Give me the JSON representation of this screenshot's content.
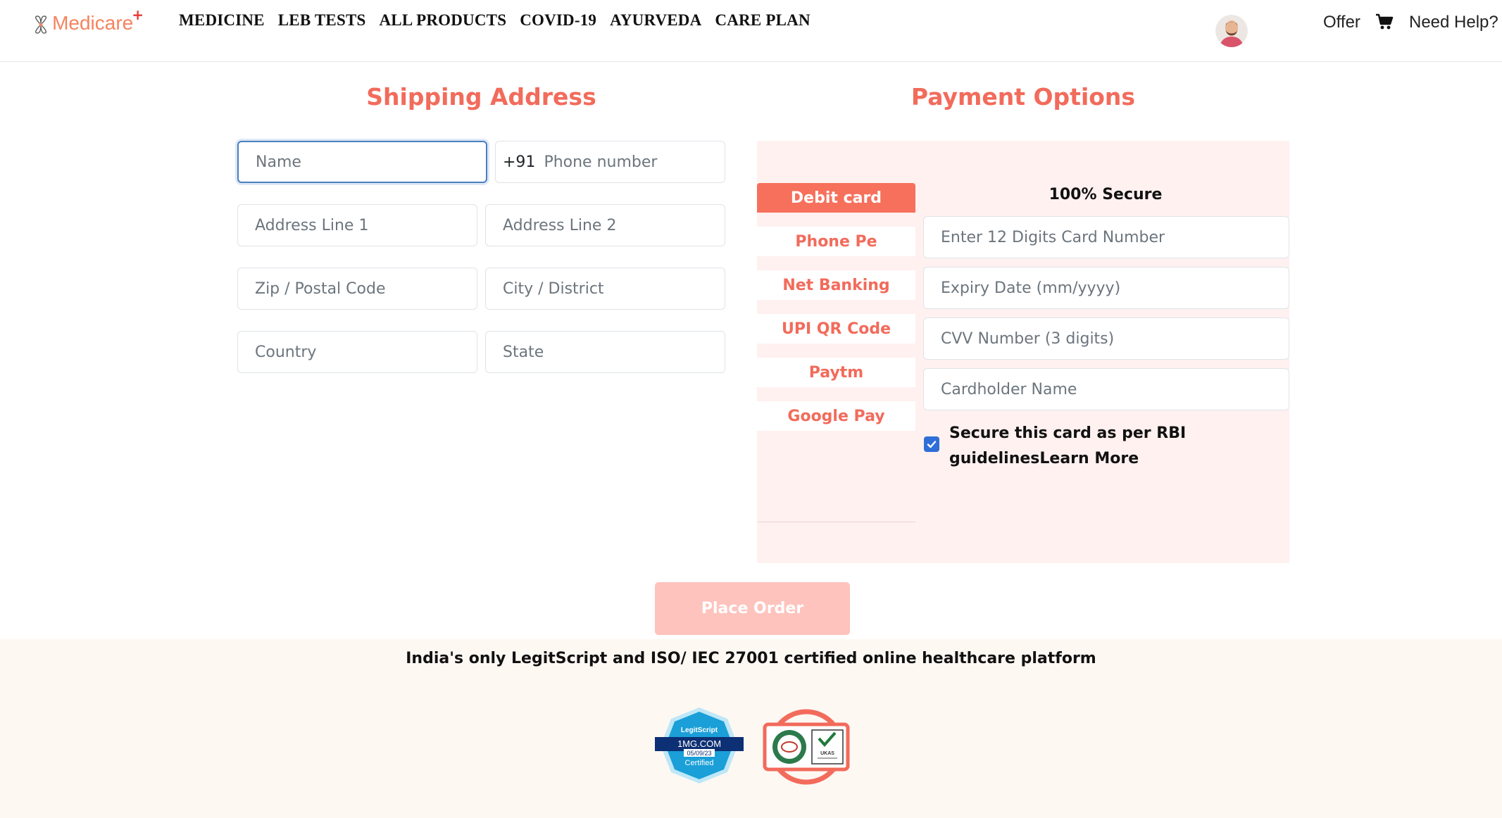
{
  "header": {
    "brand": "Medicare",
    "brand_plus": "+",
    "nav": [
      "MEDICINE",
      "LEB TESTS",
      "ALL PRODUCTS",
      "COVID-19",
      "AYURVEDA",
      "CARE PLAN"
    ],
    "offer": "Offer",
    "help": "Need Help?"
  },
  "shipping": {
    "title": "Shipping Address",
    "name_placeholder": "Name",
    "phone_prefix": "+91",
    "phone_placeholder": "Phone number",
    "address1_placeholder": "Address Line 1",
    "address2_placeholder": "Address Line 2",
    "zip_placeholder": "Zip / Postal Code",
    "city_placeholder": "City / District",
    "country_placeholder": "Country",
    "state_placeholder": "State"
  },
  "payment": {
    "title": "Payment Options",
    "tabs": [
      "Debit card",
      "Phone Pe",
      "Net Banking",
      "UPI QR Code",
      "Paytm",
      "Google Pay"
    ],
    "active_tab": "Debit card",
    "secure_label": "100% Secure",
    "card_number_placeholder": "Enter 12 Digits Card Number",
    "expiry_placeholder": "Expiry Date (mm/yyyy)",
    "cvv_placeholder": "CVV Number (3 digits)",
    "holder_placeholder": "Cardholder Name",
    "save_card_text": "Secure this card as per RBI guidelinesLearn More",
    "save_card_checked": true
  },
  "place_order": "Place Order",
  "footer": {
    "text": "India's only LegitScript and ISO/ IEC 27001 certified online healthcare platform",
    "legitscript": {
      "top": "LegitScript",
      "domain": "1MG.COM",
      "date": "05/09/23",
      "status": "Certified"
    },
    "iso_badge": {
      "tag": "UKAS"
    }
  },
  "colors": {
    "accent": "#f26b5b",
    "active_tab": "#f6705c",
    "panel_bg": "#fff1f0",
    "button_disabled": "#fec3bd",
    "footer_bg": "#fef8f3",
    "legit_blue": "#1a9fd8"
  }
}
